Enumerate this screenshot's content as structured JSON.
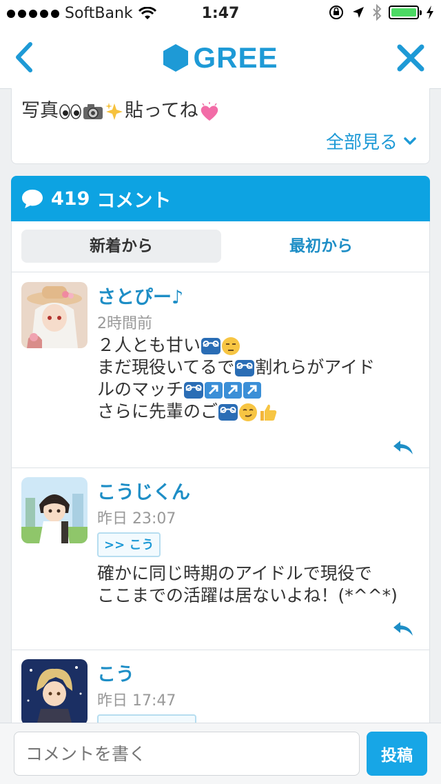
{
  "status_bar": {
    "carrier": "SoftBank",
    "time": "1:47",
    "battery_level": 1.0,
    "colors": {
      "battery": "#4cd964"
    }
  },
  "nav": {
    "logo_text": "GREE",
    "colors": {
      "brand": "#1e9ad6"
    },
    "icons": {
      "back": "chevron-left-icon",
      "close": "close-icon",
      "logo": "gree-hexagon-icon"
    }
  },
  "post": {
    "text_prefix": "写真",
    "text_suffix": "貼ってね",
    "see_all_label": "全部見る"
  },
  "comments": {
    "count": "419",
    "header_label": "コメント",
    "tabs": [
      {
        "label": "新着から",
        "active": true
      },
      {
        "label": "最初から",
        "active": false
      }
    ],
    "items": [
      {
        "name": "さとぴー♪",
        "time": "2時間前",
        "lines": [
          "２人とも甘い",
          "まだ現役いてるで",
          "割れらがアイド",
          "ルのマッチ",
          "さらに先輩のご"
        ]
      },
      {
        "name": "こうじくん",
        "time": "昨日 23:07",
        "reply_to": ">> こう",
        "lines": [
          "確かに同じ時期のアイドルで現役で",
          "ここまでの活躍は居ないよね！(*^^*)"
        ]
      },
      {
        "name": "こう",
        "time": "昨日 17:47"
      }
    ]
  },
  "composer": {
    "placeholder": "コメントを書く",
    "submit_label": "投稿"
  }
}
